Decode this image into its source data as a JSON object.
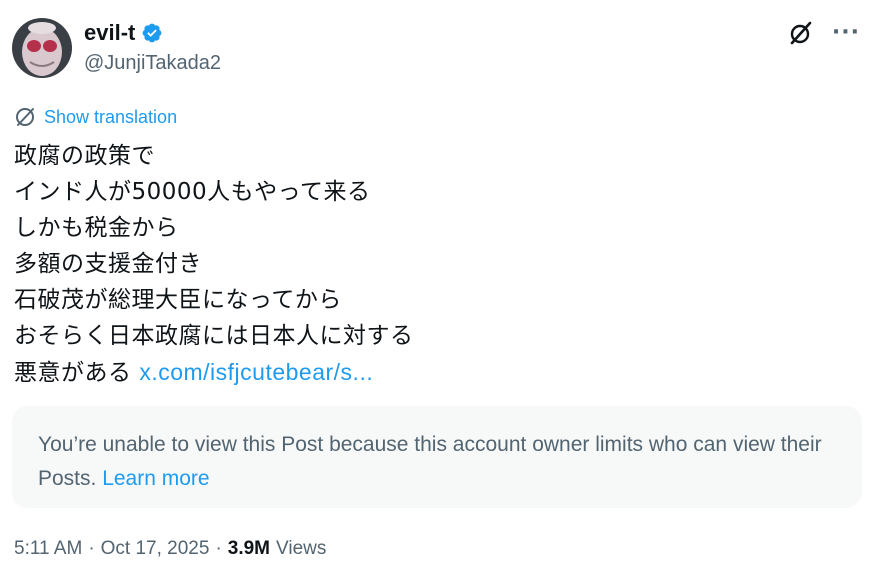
{
  "author": {
    "display_name": "evil-t",
    "handle": "@JunjiTakada2",
    "verified": true,
    "avatar_icon": "alien-mask-avatar"
  },
  "actions": {
    "grok_icon": "grok-icon",
    "more_icon": "more-icon",
    "more_label": "···"
  },
  "translation": {
    "icon": "globe-icon",
    "label": "Show translation"
  },
  "post": {
    "lines": [
      "政腐の政策で",
      "インド人が50000人もやって来る",
      "しかも税金から",
      "多額の支援金付き",
      "石破茂が総理大臣になってから",
      "おそらく日本政腐には日本人に対する",
      "悪意がある"
    ],
    "link": "x.com/isfjcutebear/s..."
  },
  "notice": {
    "text": "You’re unable to view this Post because this account owner limits who can view their Posts.",
    "link": "Learn more"
  },
  "meta": {
    "time": "5:11 AM",
    "separator": "·",
    "date": "Oct 17, 2025",
    "views_count": "3.9M",
    "views_label": "Views"
  },
  "colors": {
    "accent": "#1d9bf0",
    "text_primary": "#0f1419",
    "text_secondary": "#536471",
    "notice_bg": "#f7f9f9"
  }
}
